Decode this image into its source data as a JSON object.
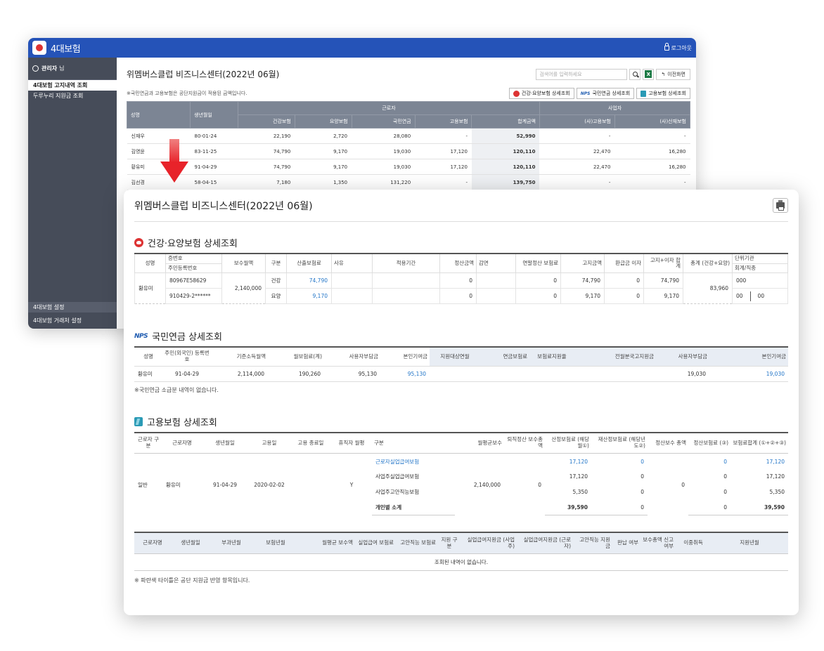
{
  "back": {
    "app_title": "4대보험",
    "logout": "로그아웃",
    "user_name": "관리자",
    "user_suffix": "님",
    "menu": [
      "4대보험 고지내역 조회",
      "두루누리 지원금 조회"
    ],
    "settings_title": "4대보험 설정",
    "settings_item": "4대보험 거래처 설정",
    "page_title": "위멤버스클럽 비즈니스센터(2022년 06월)",
    "search_placeholder": "검색어를 입력하세요",
    "excel": "X",
    "prev_label": "이전화면",
    "notice": "※국민연금과 고용보험은 공단지원금이 적용된 금액입니다.",
    "btn_health": "건강·요양보험 상세조회",
    "btn_nps_logo": "NPS",
    "btn_nps": "국민연금 상세조회",
    "btn_emp": "고용보험 상세조회",
    "headers": {
      "name": "성명",
      "birth": "생년월일",
      "worker": "근로자",
      "employer": "사업자",
      "health": "건강보험",
      "care": "요양보험",
      "pension": "국민연금",
      "employment": "고용보험",
      "total": "합계금액",
      "emp_employment": "(사)고용보험",
      "emp_industrial": "(사)산재보험"
    },
    "rows": [
      {
        "name": "신재우",
        "birth": "80-01-24",
        "health": "22,190",
        "care": "2,720",
        "pension": "28,080",
        "employment": "-",
        "total": "52,990",
        "e_emp": "-",
        "e_ind": "-"
      },
      {
        "name": "김영윤",
        "birth": "83-11-25",
        "health": "74,790",
        "care": "9,170",
        "pension": "19,030",
        "employment": "17,120",
        "total": "120,110",
        "e_emp": "22,470",
        "e_ind": "16,280"
      },
      {
        "name": "황유미",
        "birth": "91-04-29",
        "health": "74,790",
        "care": "9,170",
        "pension": "19,030",
        "employment": "17,120",
        "total": "120,110",
        "e_emp": "22,470",
        "e_ind": "16,280"
      },
      {
        "name": "김선경",
        "birth": "58-04-15",
        "health": "7,180",
        "care": "1,350",
        "pension": "131,220",
        "employment": "-",
        "total": "139,750",
        "e_emp": "-",
        "e_ind": "-"
      }
    ]
  },
  "front": {
    "page_title": "위멤버스클럽 비즈니스센터(2022년 06월)",
    "health": {
      "title": "건강·요양보험 상세조회",
      "h": {
        "name": "성명",
        "cert": "증번호",
        "reg": "주민등록번호",
        "pay": "보수월액",
        "kind": "구분",
        "calc": "산출보험료",
        "reason": "사유",
        "period": "적용기간",
        "settle": "정산금액",
        "reduce": "감면",
        "year_settle": "연말정산 보험료",
        "notice": "고지금액",
        "refund": "환급금 이자",
        "notice_int": "고지+이자 합계",
        "sum": "총계 (건강+요양)",
        "unit": "단위기관",
        "acct": "회계/직종"
      },
      "name": "황유미",
      "cert": "80967E58629",
      "reg": "910429-2******",
      "pay": "2,140,000",
      "r1": {
        "kind": "건강",
        "calc": "74,790",
        "settle": "0",
        "year": "0",
        "notice": "74,790",
        "refund": "0",
        "sum": "74,790"
      },
      "r2": {
        "kind": "요양",
        "calc": "9,170",
        "settle": "0",
        "year": "0",
        "notice": "9,170",
        "refund": "0",
        "sum": "9,170"
      },
      "total": "83,960",
      "unit": "000",
      "acct1": "00",
      "acct2": "00"
    },
    "pension": {
      "logo": "NPS",
      "title": "국민연금 상세조회",
      "h": [
        "성명",
        "주민(외국인) 등록번호",
        "기준소득월액",
        "월보험료(계)",
        "사용자부담금",
        "본인기여금",
        "지원대상연월",
        "연금보험료",
        "보험료지원율",
        "전월분국고지원금",
        "사용자부담금",
        "본인기여금"
      ],
      "row": [
        "황유미",
        "91-04-29",
        "2,114,000",
        "190,260",
        "95,130",
        "95,130",
        "",
        "",
        "",
        "",
        "19,030",
        "19,030"
      ],
      "note": "※국민연금 소급분 내역이 없습니다."
    },
    "employment": {
      "title": "고용보험 상세조회",
      "h": [
        "근로자 구분",
        "근로자명",
        "생년월일",
        "고용일",
        "고용 종료일",
        "휴직자 월평",
        "구분",
        "월평균보수",
        "퇴직정산 보수총액",
        "산정보험료 (해당월①)",
        "재산정보험료 (해당년도②)",
        "정산보수 총액",
        "정산보험료 (③)",
        "보험료합계 (①+②+③)"
      ],
      "type": "일반",
      "name": "황유미",
      "birth": "91-04-29",
      "hire": "2020-02-02",
      "end": "",
      "leave": "Y",
      "avg": "2,140,000",
      "retire": "0",
      "settle_total": "0",
      "rows": [
        {
          "kind": "근로자실업급여보험",
          "calc": "17,120",
          "recalc": "0",
          "settle": "0",
          "sum": "17,120"
        },
        {
          "kind": "사업주실업급여보험",
          "calc": "17,120",
          "recalc": "0",
          "settle": "0",
          "sum": "17,120"
        },
        {
          "kind": "사업주고안직능보험",
          "calc": "5,350",
          "recalc": "0",
          "settle": "0",
          "sum": "5,350"
        },
        {
          "kind": "개인별 소계",
          "calc": "39,590",
          "recalc": "0",
          "settle": "0",
          "sum": "39,590"
        }
      ],
      "h2": [
        "근로자명",
        "생년월일",
        "부과년월",
        "보험년월",
        "월평균 보수액",
        "실업급여 보험료",
        "고안직능 보험료",
        "지원 구분",
        "실업급여지원금 (사업주)",
        "실업급여지원금 (근로자)",
        "고안직능 지원금",
        "완납 여부",
        "보수총액 신고여부",
        "이중취득",
        "지원년월"
      ],
      "empty": "조회된 내역이 없습니다.",
      "note": "※ 파란색 타이틀은 공단 지원금 반영 항목입니다."
    }
  }
}
